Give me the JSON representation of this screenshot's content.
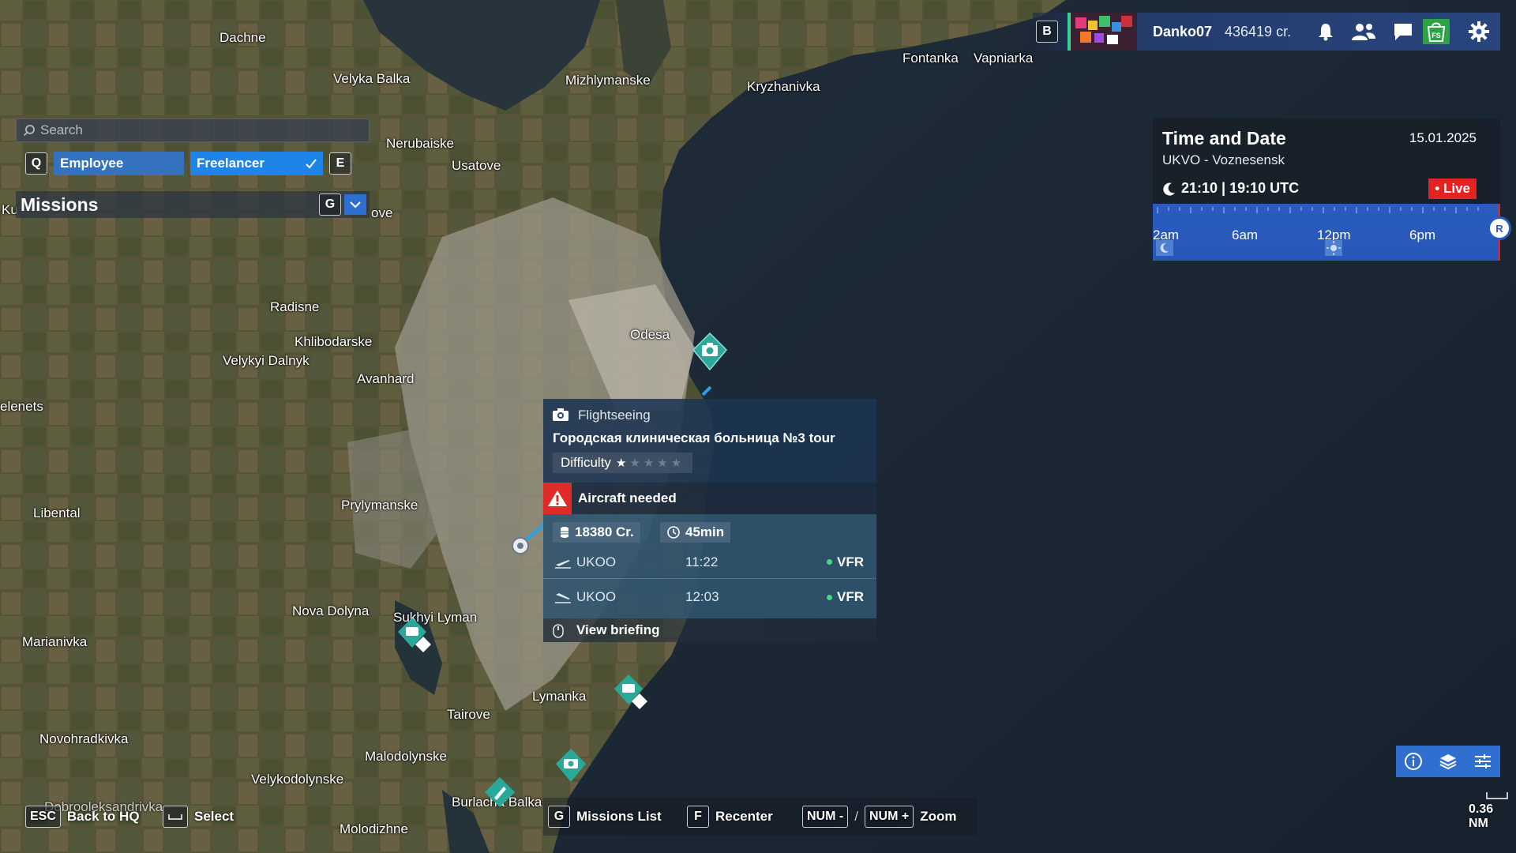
{
  "map": {
    "places": [
      {
        "name": "Dachne"
      },
      {
        "name": "Velyka Balka"
      },
      {
        "name": "Mizhlymanske"
      },
      {
        "name": "Kryzhanivka"
      },
      {
        "name": "Fontanka"
      },
      {
        "name": "Vapniarka"
      },
      {
        "name": "Nerubaiske"
      },
      {
        "name": "Usatove"
      },
      {
        "name": "Radisne"
      },
      {
        "name": "Khlibodarske"
      },
      {
        "name": "Velykyi Dalnyk"
      },
      {
        "name": "Avanhard"
      },
      {
        "name": "Odesa"
      },
      {
        "name": "Prylymanske"
      },
      {
        "name": "Libental"
      },
      {
        "name": "Nova Dolyna"
      },
      {
        "name": "Sukhyi Lyman"
      },
      {
        "name": "Marianivka"
      },
      {
        "name": "Lymanka"
      },
      {
        "name": "Tairove"
      },
      {
        "name": "Novohradkivka"
      },
      {
        "name": "Malodolynske"
      },
      {
        "name": "Velykodolynske"
      },
      {
        "name": "Dobrooleksandrivka"
      },
      {
        "name": "Burlacha Balka"
      },
      {
        "name": "Molodizhne"
      },
      {
        "name": "elenets"
      },
      {
        "name": "Ku"
      },
      {
        "name": "ove"
      }
    ]
  },
  "left_panel": {
    "search_placeholder": "Search",
    "key_prev": "Q",
    "key_next": "E",
    "filters": [
      {
        "label": "Employee",
        "selected": false
      },
      {
        "label": "Freelancer",
        "selected": true
      }
    ],
    "missions_title": "Missions",
    "missions_key": "G"
  },
  "top_bar": {
    "key": "B",
    "username": "Danko07",
    "credits": "436419 cr.",
    "icons": [
      "bell-icon",
      "friends-icon",
      "chat-icon",
      "marketplace-icon",
      "gear-icon"
    ],
    "store_label": "FS"
  },
  "time_panel": {
    "title": "Time and Date",
    "date": "15.01.2025",
    "airport": "UKVO - Voznesensk",
    "time": "21:10 | 19:10 UTC",
    "live_label": "Live",
    "timeline_labels": [
      "2am",
      "6am",
      "12pm",
      "6pm"
    ],
    "reset_label": "R"
  },
  "mission_card": {
    "type": "Flightseeing",
    "name": "Городская клиническая больница №3 tour",
    "difficulty_label": "Difficulty",
    "difficulty_stars": 1,
    "difficulty_max": 5,
    "warning": "Aircraft needed",
    "reward": "18380 Cr.",
    "duration": "45min",
    "legs": [
      {
        "airport": "UKOO",
        "time": "11:22",
        "rules": "VFR",
        "kind": "departure"
      },
      {
        "airport": "UKOO",
        "time": "12:03",
        "rules": "VFR",
        "kind": "arrival"
      }
    ],
    "briefing_label": "View briefing"
  },
  "bottom_hints": {
    "back_key": "ESC",
    "back_label": "Back to HQ",
    "select_label": "Select",
    "missions_key": "G",
    "missions_label": "Missions List",
    "recenter_key": "F",
    "recenter_label": "Recenter",
    "zoom_out_key": "NUM -",
    "zoom_sep": "/",
    "zoom_in_key": "NUM +",
    "zoom_label": "Zoom"
  },
  "map_tools": {
    "icons": [
      "info-icon",
      "layers-icon",
      "legend-icon"
    ]
  },
  "scale_label": "0.36 NM",
  "colors": {
    "accent_blue": "#2f6fd0",
    "live_red": "#e32222",
    "marker_teal": "#2aa89a",
    "warning_red": "#e02b2b",
    "vfr_green": "#3ddc84"
  }
}
